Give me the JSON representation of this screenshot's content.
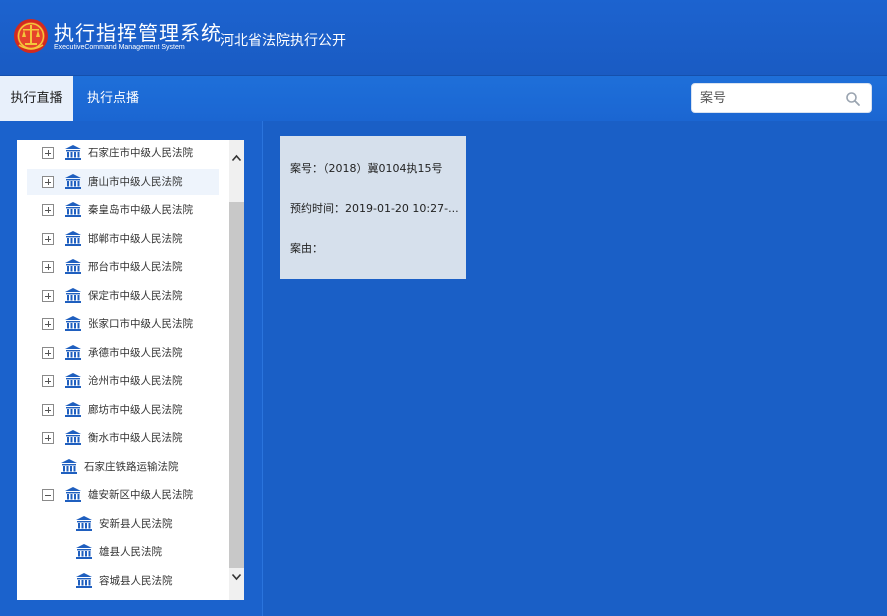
{
  "header": {
    "title_cn": "执行指挥管理系统",
    "title_en": "ExecutiveCommand Management System",
    "subtitle": "河北省法院执行公开"
  },
  "nav": {
    "tabs": [
      {
        "label": "执行直播",
        "active": true
      },
      {
        "label": "执行点播",
        "active": false
      }
    ],
    "search_placeholder": "案号"
  },
  "tree": {
    "items": [
      {
        "label": "石家庄市中级人民法院",
        "toggle": "plus",
        "level": 0
      },
      {
        "label": "唐山市中级人民法院",
        "toggle": "plus",
        "level": 0
      },
      {
        "label": "秦皇岛市中级人民法院",
        "toggle": "plus",
        "level": 0
      },
      {
        "label": "邯郸市中级人民法院",
        "toggle": "plus",
        "level": 0
      },
      {
        "label": "邢台市中级人民法院",
        "toggle": "plus",
        "level": 0
      },
      {
        "label": "保定市中级人民法院",
        "toggle": "plus",
        "level": 0
      },
      {
        "label": "张家口市中级人民法院",
        "toggle": "plus",
        "level": 0
      },
      {
        "label": "承德市中级人民法院",
        "toggle": "plus",
        "level": 0
      },
      {
        "label": "沧州市中级人民法院",
        "toggle": "plus",
        "level": 0
      },
      {
        "label": "廊坊市中级人民法院",
        "toggle": "plus",
        "level": 0
      },
      {
        "label": "衡水市中级人民法院",
        "toggle": "plus",
        "level": 0
      },
      {
        "label": "石家庄铁路运输法院",
        "toggle": "none",
        "level": 0
      },
      {
        "label": "雄安新区中级人民法院",
        "toggle": "minus",
        "level": 0
      },
      {
        "label": "安新县人民法院",
        "toggle": "none",
        "level": 1
      },
      {
        "label": "雄县人民法院",
        "toggle": "none",
        "level": 1
      },
      {
        "label": "容城县人民法院",
        "toggle": "none",
        "level": 1
      }
    ]
  },
  "card": {
    "case_no": "案号：（2018）冀0104执15号",
    "appointment": "预约时间：2019-01-20 10:27-...",
    "cause": "案由："
  },
  "colors": {
    "header_bg": "#1c63cf",
    "card_bg": "#d6e0ec",
    "icon_blue": "#1f5fbf"
  }
}
